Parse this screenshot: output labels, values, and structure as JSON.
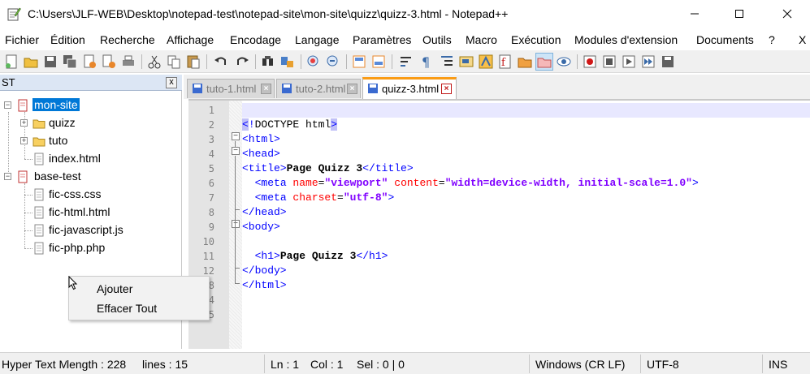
{
  "window": {
    "title": "C:\\Users\\JLF-WEB\\Desktop\\notepad-test\\notepad-site\\mon-site\\quizz\\quizz-3.html - Notepad++"
  },
  "menu": [
    "Fichier",
    "Édition",
    "Recherche",
    "Affichage",
    "Encodage",
    "Langage",
    "Paramètres",
    "Outils",
    "Macro",
    "Exécution",
    "Modules d'extension",
    "Documents",
    "?"
  ],
  "menu_close": "X",
  "panel": {
    "title": "ST",
    "close": "x",
    "tree": [
      {
        "label": "mon-site",
        "type": "folder-red",
        "expanded": true,
        "selected": true
      },
      {
        "label": "quizz",
        "type": "folder",
        "expanded": false
      },
      {
        "label": "tuto",
        "type": "folder",
        "expanded": false
      },
      {
        "label": "index.html",
        "type": "file"
      },
      {
        "label": "base-test",
        "type": "folder-red",
        "expanded": true
      },
      {
        "label": "fic-css.css",
        "type": "file"
      },
      {
        "label": "fic-html.html",
        "type": "file"
      },
      {
        "label": "fic-javascript.js",
        "type": "file"
      },
      {
        "label": "fic-php.php",
        "type": "file"
      }
    ]
  },
  "context_menu": {
    "items": [
      "Ajouter",
      "Effacer Tout"
    ]
  },
  "tabs": [
    {
      "label": "tuto-1.html",
      "active": false
    },
    {
      "label": "tuto-2.html",
      "active": false
    },
    {
      "label": "quizz-3.html",
      "active": true
    }
  ],
  "editor": {
    "line_numbers": [
      "1",
      "2",
      "3",
      "4",
      "5",
      "6",
      "7",
      "8",
      "9",
      "10",
      "11",
      "12",
      "8",
      "4",
      "5"
    ],
    "lines": [
      {
        "html_tokens": []
      },
      {
        "tokens": [
          [
            "tag",
            "<"
          ],
          [
            "tag",
            "!"
          ],
          [
            "plain",
            "DOCTYPE html"
          ],
          [
            "tag",
            ">"
          ]
        ]
      },
      {
        "tokens": [
          [
            "tag",
            "<html>"
          ]
        ]
      },
      {
        "tokens": [
          [
            "tag",
            "<head>"
          ]
        ]
      },
      {
        "tokens": [
          [
            "tag",
            "<title>"
          ],
          [
            "txt",
            "Page Quizz 3"
          ],
          [
            "tag",
            "</title>"
          ]
        ]
      },
      {
        "tokens": [
          [
            "plain",
            "  "
          ],
          [
            "tag",
            "<meta "
          ],
          [
            "attr",
            "name"
          ],
          [
            "plain",
            "="
          ],
          [
            "val",
            "\"viewport\""
          ],
          [
            "plain",
            " "
          ],
          [
            "attr",
            "content"
          ],
          [
            "plain",
            "="
          ],
          [
            "val",
            "\"width=device-width, initial-scale=1.0\""
          ],
          [
            "tag",
            ">"
          ]
        ]
      },
      {
        "tokens": [
          [
            "plain",
            "  "
          ],
          [
            "tag",
            "<meta "
          ],
          [
            "attr",
            "charset"
          ],
          [
            "plain",
            "="
          ],
          [
            "val",
            "\"utf-8\""
          ],
          [
            "tag",
            ">"
          ]
        ]
      },
      {
        "tokens": [
          [
            "tag",
            "</head>"
          ]
        ]
      },
      {
        "tokens": [
          [
            "tag",
            "<body>"
          ]
        ]
      },
      {
        "tokens": []
      },
      {
        "tokens": [
          [
            "plain",
            "  "
          ],
          [
            "tag",
            "<h1>"
          ],
          [
            "txt",
            "Page Quizz 3"
          ],
          [
            "tag",
            "</h1>"
          ]
        ]
      },
      {
        "tokens": [
          [
            "tag",
            "</body>"
          ]
        ]
      },
      {
        "tokens": [
          [
            "tag",
            "</html>"
          ]
        ]
      }
    ]
  },
  "status": {
    "lang": "Hyper Text Ma",
    "length": "length : 228",
    "lines": "lines : 15",
    "ln": "Ln : 1",
    "col": "Col : 1",
    "sel": "Sel : 0 | 0",
    "eol": "Windows (CR LF)",
    "encoding": "UTF-8",
    "mode": "INS"
  },
  "colors": {
    "tag": "#0000ff",
    "attr": "#ff0000",
    "value": "#8000ff",
    "selection": "#0078d7",
    "active_tab": "#fa9c16"
  }
}
